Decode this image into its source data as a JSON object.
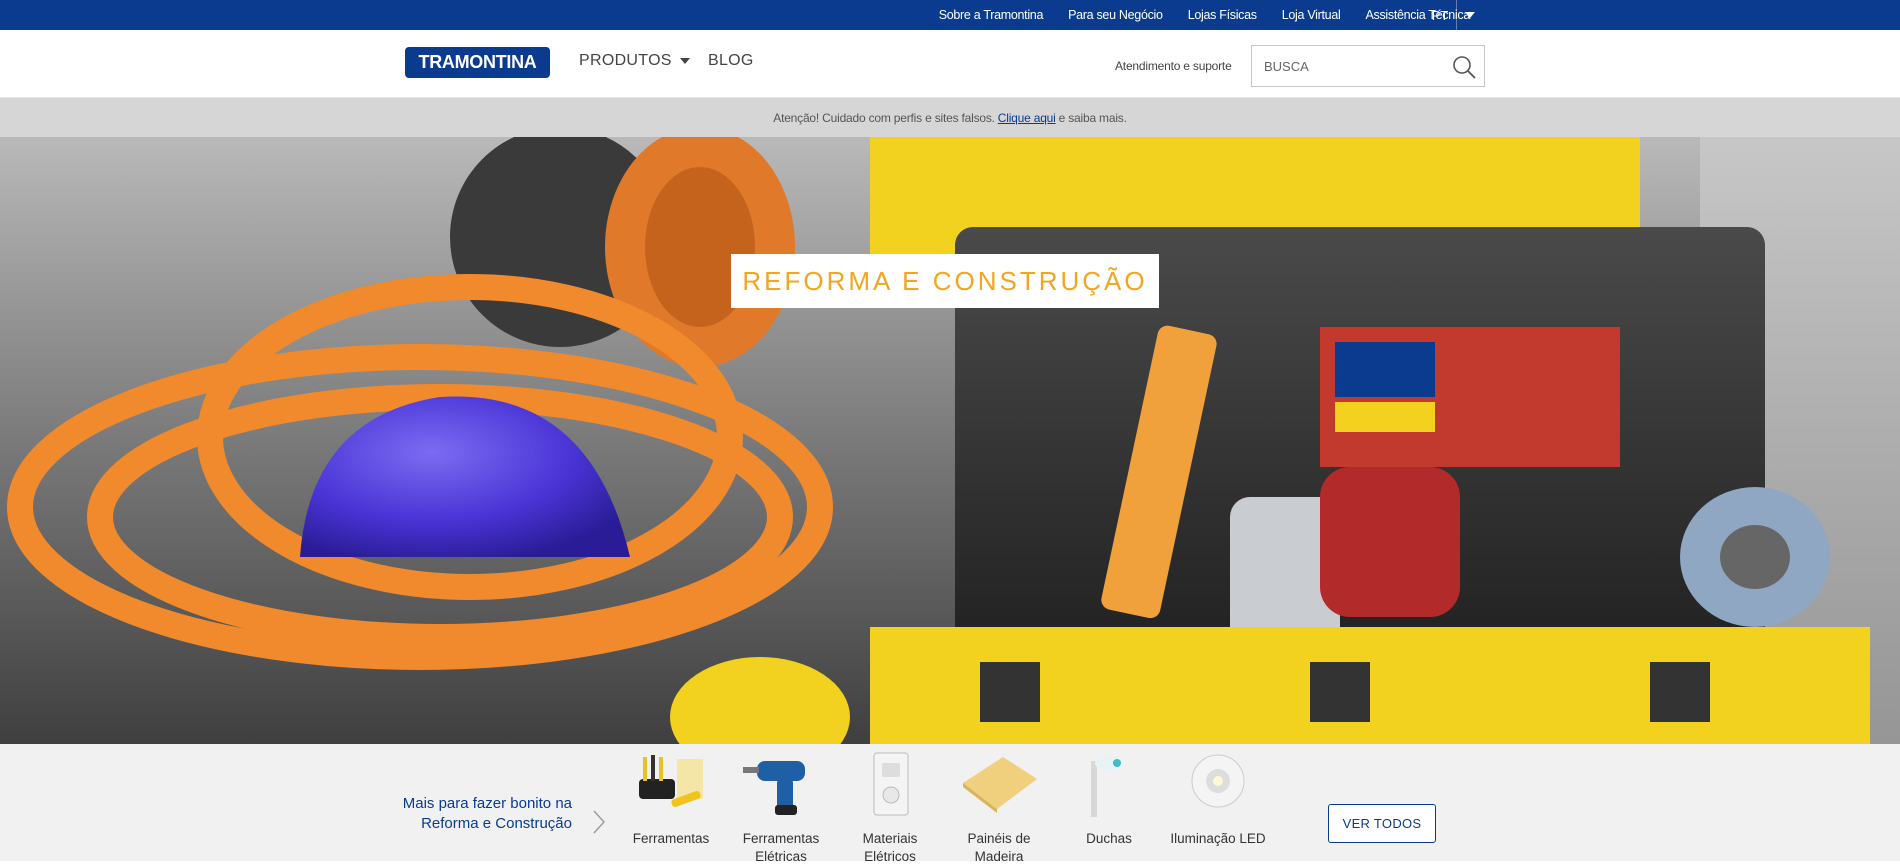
{
  "topbar": {
    "links": [
      "Sobre a Tramontina",
      "Para seu Negócio",
      "Lojas Físicas",
      "Loja Virtual",
      "Assistência Técnica"
    ],
    "language": "PT"
  },
  "header": {
    "logo_text": "TRAMONTINA",
    "nav": {
      "produtos": "PRODUTOS",
      "blog": "BLOG"
    },
    "support_link": "Atendimento e suporte",
    "search": {
      "placeholder": "BUSCA"
    }
  },
  "alert": {
    "text_before": "Atenção! Cuidado com perfis e sites falsos.",
    "link": "Clique aqui",
    "text_after": "e saiba mais."
  },
  "hero": {
    "title": "REFORMA E CONSTRUÇÃO"
  },
  "categories": {
    "intro_line1": "Mais para fazer bonito na",
    "intro_line2": "Reforma e Construção",
    "items": [
      {
        "label": "Ferramentas"
      },
      {
        "label": "Ferramentas Elétricas"
      },
      {
        "label": "Materiais Elétricos"
      },
      {
        "label": "Painéis de Madeira"
      },
      {
        "label": "Duchas"
      },
      {
        "label": "Iluminação LED"
      }
    ],
    "see_all": "VER TODOS"
  },
  "colors": {
    "brand_blue": "#0a3b8f",
    "hero_title_orange": "#f3a51e",
    "alert_bg": "#d6d6d6"
  },
  "icons": [
    "search-icon",
    "chevron-down-icon",
    "chevron-right-icon"
  ]
}
